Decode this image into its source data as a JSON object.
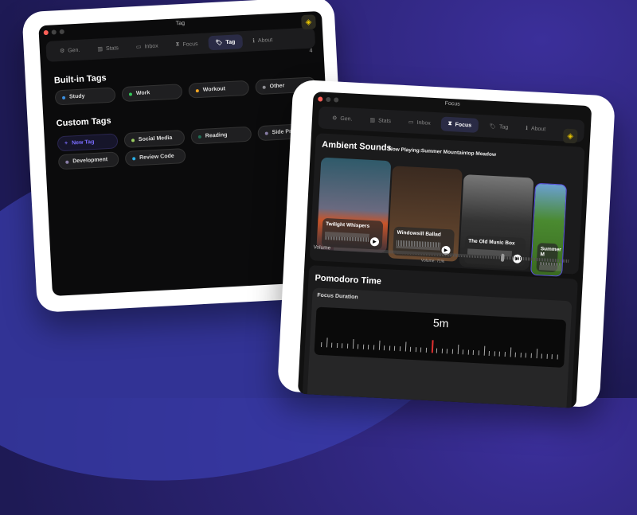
{
  "tag_window": {
    "title": "Tag",
    "tabs": [
      {
        "label": "Gen.",
        "icon": "⚙"
      },
      {
        "label": "Stats",
        "icon": "▥"
      },
      {
        "label": "Inbox",
        "icon": "▭"
      },
      {
        "label": "Focus",
        "icon": "⧗"
      },
      {
        "label": "Tag",
        "icon": "🏷"
      },
      {
        "label": "About",
        "icon": "ℹ"
      }
    ],
    "count": "4",
    "builtin_heading": "Built-in Tags",
    "builtin": [
      {
        "label": "Study",
        "color": "#3b8fe0"
      },
      {
        "label": "Work",
        "color": "#34c759"
      },
      {
        "label": "Workout",
        "color": "#f5a623"
      },
      {
        "label": "Other",
        "color": "#8e8e93"
      }
    ],
    "custom_heading": "Custom Tags",
    "new_tag": "New Tag",
    "custom": [
      {
        "label": "Social Media",
        "color": "#9acd60"
      },
      {
        "label": "Reading",
        "color": "#1f6f55"
      },
      {
        "label": "Side Project",
        "color": "#8a7fa8"
      },
      {
        "label": "Development",
        "color": "#8a7fa8"
      },
      {
        "label": "Review Code",
        "color": "#2ab0e8"
      }
    ]
  },
  "focus_window": {
    "title": "Focus",
    "tabs": [
      {
        "label": "Gen.",
        "icon": "⚙"
      },
      {
        "label": "Stats",
        "icon": "▥"
      },
      {
        "label": "Inbox",
        "icon": "▭"
      },
      {
        "label": "Focus",
        "icon": "⧗"
      },
      {
        "label": "Tag",
        "icon": "🏷"
      },
      {
        "label": "About",
        "icon": "ℹ"
      }
    ],
    "ambient_heading": "Ambient Sounds",
    "now_playing": "Now Playing:Summer Mountaintop Meadow",
    "sounds": [
      "Twilight Whispers",
      "Windowsill Ballad",
      "The Old Music Box",
      "Summer M"
    ],
    "volume_label": "Volume",
    "volume_text": "Volume: 71%",
    "volume": 0.71,
    "pomodoro_heading": "Pomodoro Time",
    "focus_duration_label": "Focus Duration",
    "duration_value": "5m"
  }
}
